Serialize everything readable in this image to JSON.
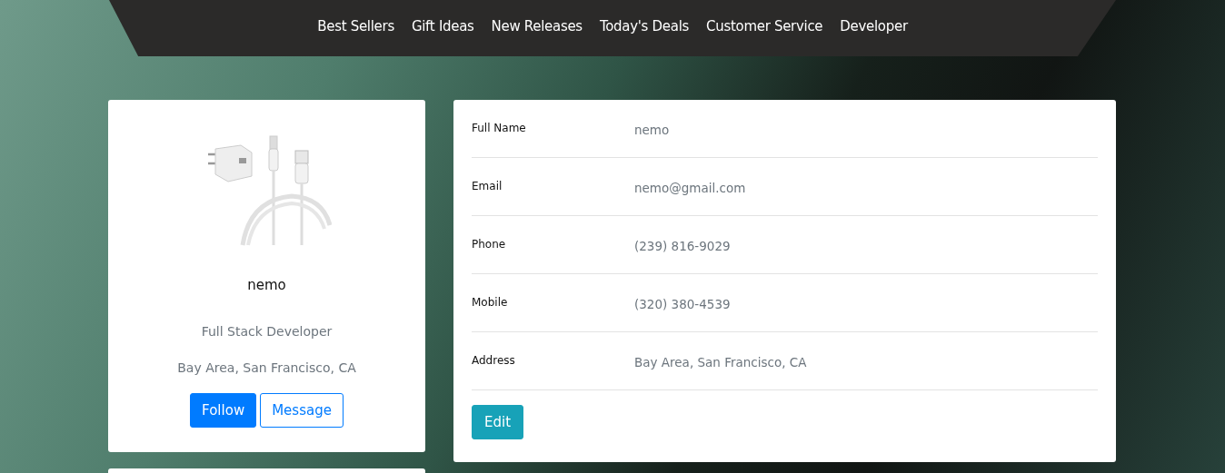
{
  "nav": {
    "links": [
      "Best Sellers",
      "Gift Ideas",
      "New Releases",
      "Today's Deals",
      "Customer Service",
      "Developer"
    ]
  },
  "profile": {
    "name": "nemo",
    "title": "Full Stack Developer",
    "location": "Bay Area, San Francisco, CA",
    "buttons": [
      {
        "label": "Follow",
        "kind": "primary"
      },
      {
        "label": "Message",
        "kind": "outline"
      }
    ]
  },
  "details": {
    "rows": [
      {
        "label": "Full Name",
        "value": "nemo"
      },
      {
        "label": "Email",
        "value": "nemo@gmail.com"
      },
      {
        "label": "Phone",
        "value": "(239) 816-9029"
      },
      {
        "label": "Mobile",
        "value": "(320) 380-4539"
      },
      {
        "label": "Address",
        "value": "Bay Area, San Francisco, CA"
      }
    ],
    "button": "Edit"
  }
}
